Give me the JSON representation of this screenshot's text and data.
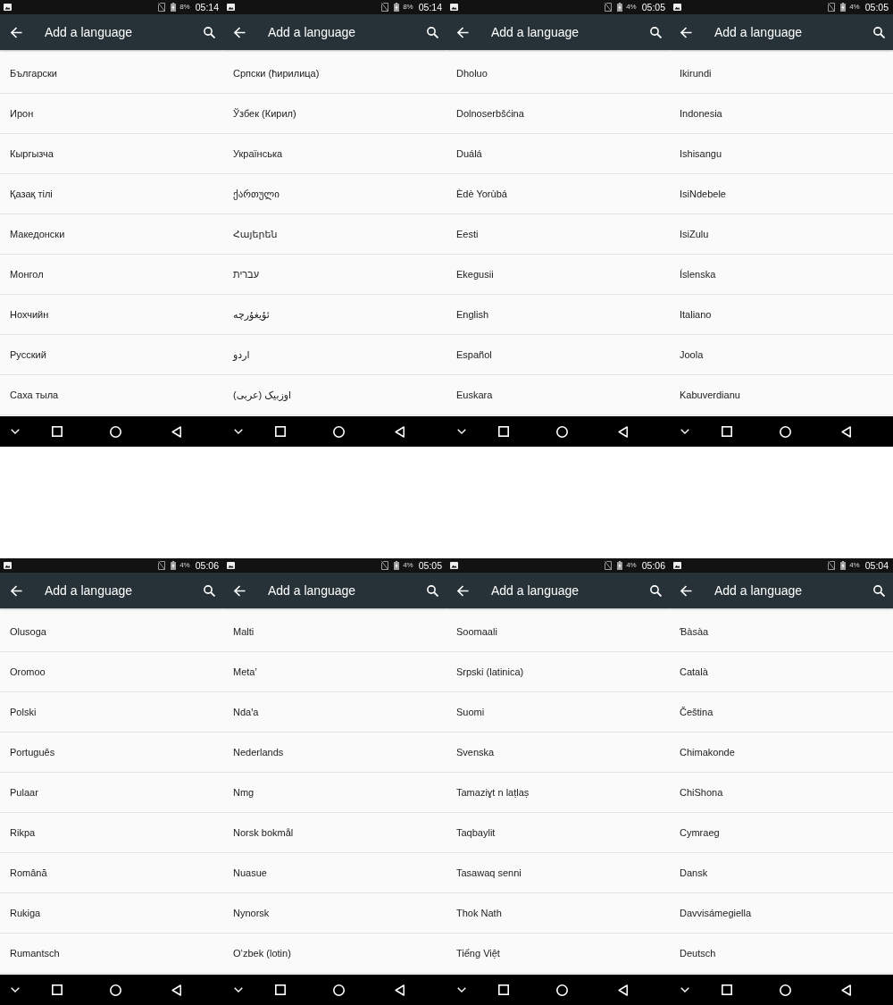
{
  "screens": [
    {
      "status_bar": {
        "battery": "8%",
        "time": "05:14"
      },
      "app_bar": {
        "title": "Add a language"
      },
      "languages": [
        "Български",
        "Ирон",
        "Кыргызча",
        "Қазақ тілі",
        "Македонски",
        "Монгол",
        "Нохчийн",
        "Русский",
        "Саха тыла"
      ]
    },
    {
      "status_bar": {
        "battery": "8%",
        "time": "05:14"
      },
      "app_bar": {
        "title": "Add a language"
      },
      "languages": [
        "Српски (ћирилица)",
        "Ўзбек (Кирил)",
        "Українська",
        "ქართული",
        "Հայերեն",
        "עברית",
        "ئۇيغۇرچە",
        "اردو",
        "اوزبیک (عربی)"
      ]
    },
    {
      "status_bar": {
        "battery": "4%",
        "time": "05:05"
      },
      "app_bar": {
        "title": "Add a language"
      },
      "languages": [
        "Dholuo",
        "Dolnoserbšćina",
        "Duálá",
        "Èdè Yorùbá",
        "Eesti",
        "Ekegusii",
        "English",
        "Español",
        "Euskara"
      ]
    },
    {
      "status_bar": {
        "battery": "4%",
        "time": "05:05"
      },
      "app_bar": {
        "title": "Add a language"
      },
      "languages": [
        "Ikirundi",
        "Indonesia",
        "Ishisangu",
        "IsiNdebele",
        "IsiZulu",
        "Íslenska",
        "Italiano",
        "Joola",
        "Kabuverdianu"
      ]
    },
    {
      "status_bar": {
        "battery": "4%",
        "time": "05:06"
      },
      "app_bar": {
        "title": "Add a language"
      },
      "languages": [
        "Olusoga",
        "Oromoo",
        "Polski",
        "Português",
        "Pulaar",
        "Rikpa",
        "Română",
        "Rukiga",
        "Rumantsch"
      ]
    },
    {
      "status_bar": {
        "battery": "4%",
        "time": "05:05"
      },
      "app_bar": {
        "title": "Add a language"
      },
      "languages": [
        "Malti",
        "Metaʼ",
        "Ndaꞌa",
        "Nederlands",
        "Nmg",
        "Norsk bokmål",
        "Nuasue",
        "Nynorsk",
        "Oʻzbek (lotin)"
      ]
    },
    {
      "status_bar": {
        "battery": "4%",
        "time": "05:06"
      },
      "app_bar": {
        "title": "Add a language"
      },
      "languages": [
        "Soomaali",
        "Srpski (latinica)",
        "Suomi",
        "Svenska",
        "Tamaziɣt n laṭlaṣ",
        "Taqbaylit",
        "Tasawaq senni",
        "Thok Nath",
        "Tiếng Việt"
      ]
    },
    {
      "status_bar": {
        "battery": "4%",
        "time": "05:04"
      },
      "app_bar": {
        "title": "Add a language"
      },
      "languages": [
        "Ɓàsàa",
        "Català",
        "Čeština",
        "Chimakonde",
        "ChiShona",
        "Cymraeg",
        "Dansk",
        "Davvisámegiella",
        "Deutsch"
      ]
    }
  ]
}
